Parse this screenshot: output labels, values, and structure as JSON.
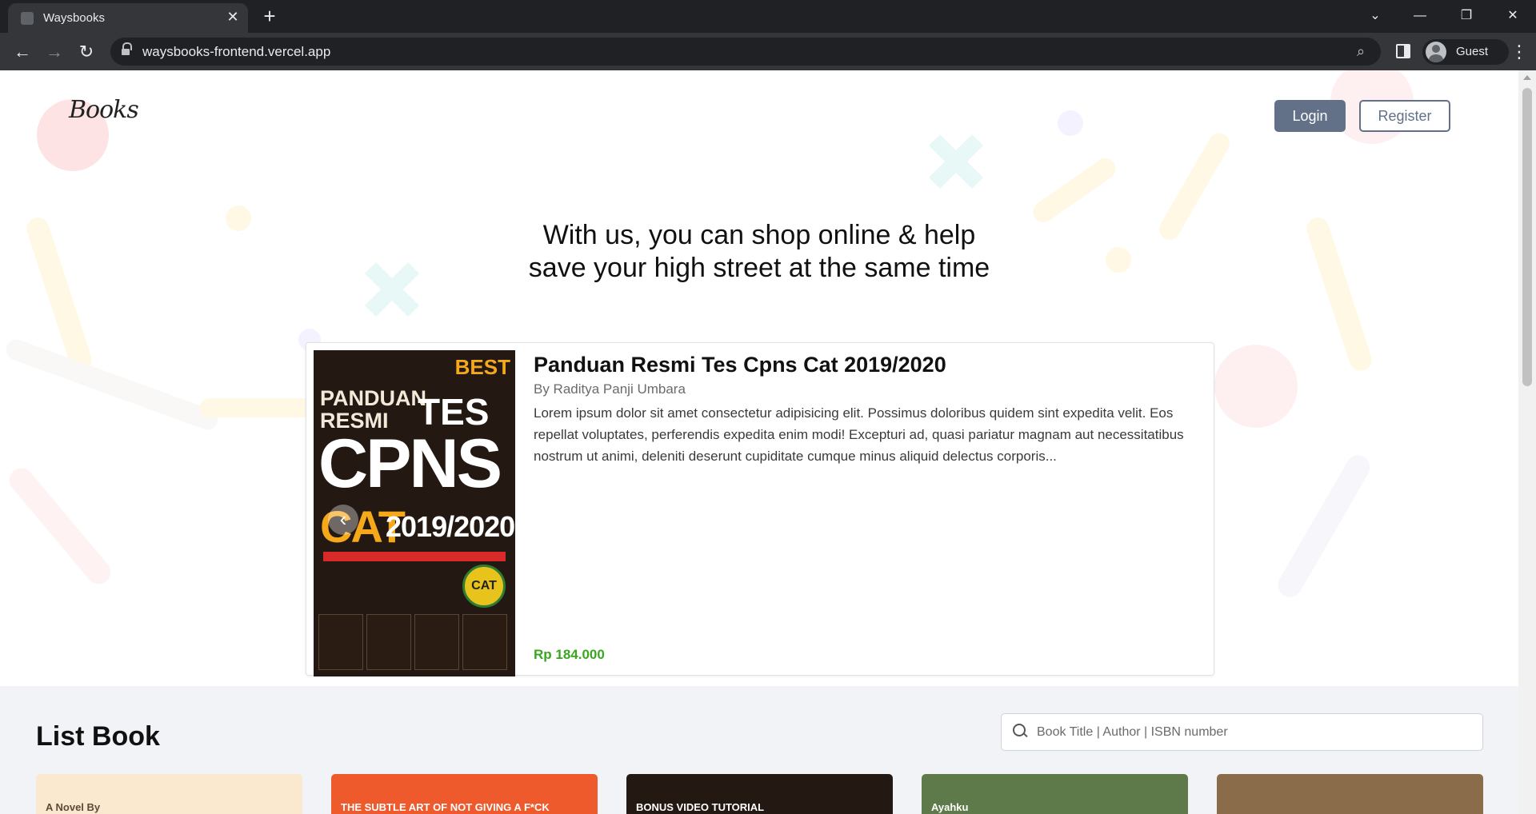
{
  "browser": {
    "tab_title": "Waysbooks",
    "url": "waysbooks-frontend.vercel.app",
    "profile_label": "Guest"
  },
  "header": {
    "logo_text": "Books",
    "login_label": "Login",
    "register_label": "Register"
  },
  "hero": {
    "line1": "With us, you can shop online & help",
    "line2": "save your high street at the same time"
  },
  "featured": {
    "title": "Panduan Resmi Tes Cpns Cat 2019/2020",
    "author": "By Raditya Panji Umbara",
    "description": "Lorem ipsum dolor sit amet consectetur adipisicing elit. Possimus doloribus quidem sint expedita velit. Eos repellat voluptates, perferendis expedita enim modi! Excepturi ad, quasi pariatur magnam aut necessitatibus nostrum ut animi, deleniti deserunt cupiditate cumque minus aliquid delectus corporis...",
    "price": "Rp 184.000",
    "cover": {
      "line1": "PANDUAN",
      "line2": "RESMI",
      "tes": "TES",
      "cpns": "CPNS",
      "cat": "CAT",
      "year": "2019/2020",
      "badge": "BEST",
      "cd": "CAT"
    }
  },
  "list": {
    "title": "List Book",
    "search_placeholder": "Book Title | Author | ISBN number",
    "books": [
      {
        "cover_text": "A Novel By",
        "bg": "#fbe9cf",
        "fg": "#5a4a3a"
      },
      {
        "cover_text": "THE SUBTLE ART OF NOT GIVING A F*CK",
        "bg": "#ef5a2c",
        "fg": "#ffffff"
      },
      {
        "cover_text": "BONUS VIDEO TUTORIAL",
        "bg": "#231812",
        "fg": "#ffffff"
      },
      {
        "cover_text": "Ayahku",
        "bg": "#5f7a4a",
        "fg": "#ffffff"
      },
      {
        "cover_text": "",
        "bg": "#8a6b4a",
        "fg": "#ffffff"
      }
    ]
  },
  "colors": {
    "accent": "#627088",
    "price_green": "#3aa61f",
    "list_bg": "#f2f3f7"
  }
}
